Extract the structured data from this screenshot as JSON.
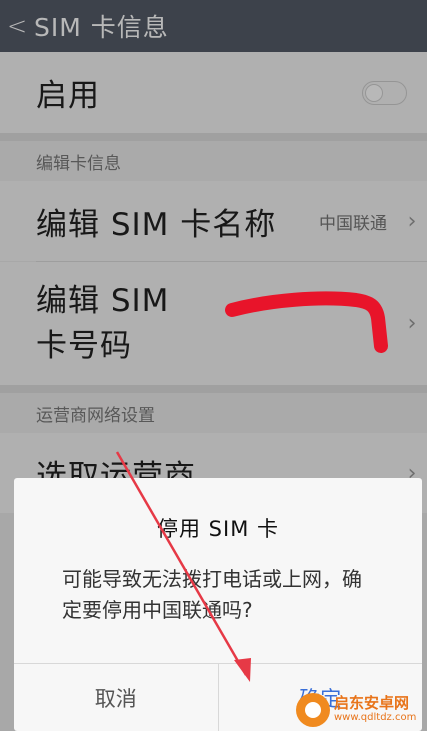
{
  "header": {
    "back_glyph": "<",
    "title": "SIM 卡信息"
  },
  "enable_row": {
    "label": "启用",
    "toggle_on": false
  },
  "section_card_info": {
    "label": "编辑卡信息"
  },
  "edit_name_row": {
    "label": "编辑 SIM 卡名称",
    "value": "中国联通"
  },
  "edit_number_row": {
    "label_line1": "编辑 SIM",
    "label_line2": "卡号码"
  },
  "section_carrier": {
    "label": "运营商网络设置"
  },
  "carrier_row": {
    "label": "选取运营商"
  },
  "dialog": {
    "title": "停用 SIM 卡",
    "message": "可能导致无法拨打电话或上网，确定要停用中国联通吗?",
    "cancel_label": "取消",
    "confirm_label": "确定"
  },
  "watermark": {
    "brand": "启东安卓网",
    "url": "www.qdltdz.com"
  },
  "colors": {
    "titlebar": "#555c69",
    "annotation_red": "#e8142a",
    "watermark_orange": "#f08a1f"
  },
  "icons": [
    "chevron-left-icon",
    "chevron-right-icon",
    "toggle-switch"
  ]
}
